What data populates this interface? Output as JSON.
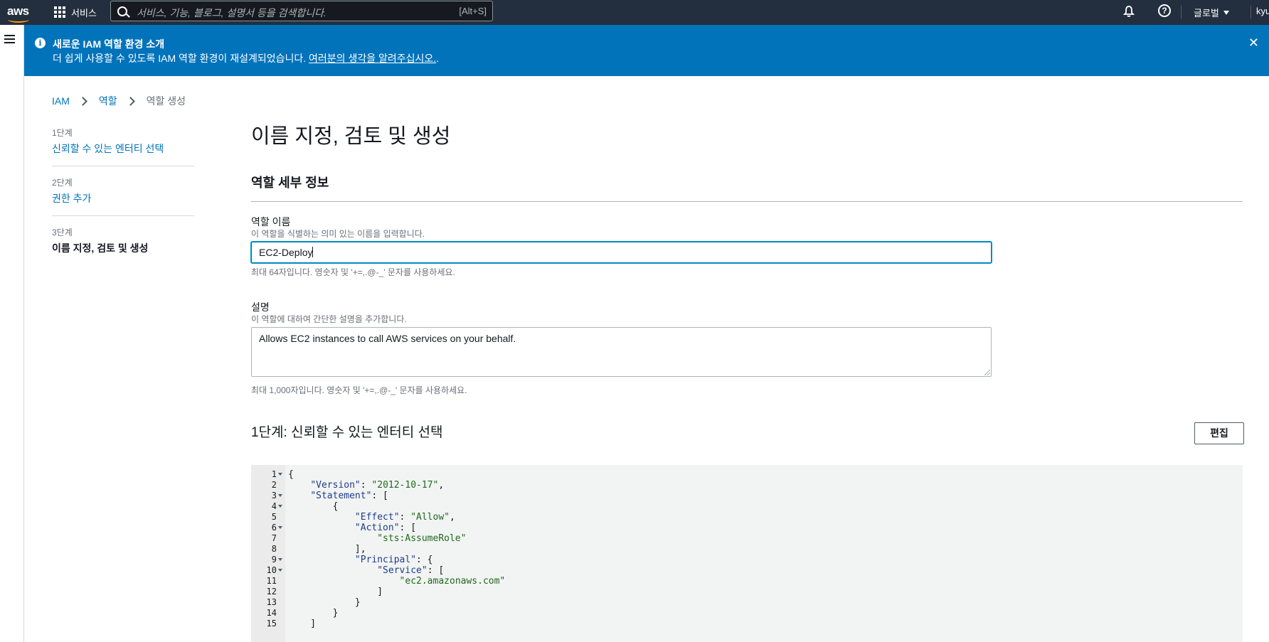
{
  "topnav": {
    "logo_text": "aws",
    "services_label": "서비스",
    "search_placeholder": "서비스, 기능, 블로그, 설명서 등을 검색합니다.",
    "search_shortcut": "[Alt+S]",
    "region_label": "글로벌",
    "user_label": "kyu"
  },
  "banner": {
    "title": "새로운 IAM 역할 환경 소개",
    "message": "더 쉽게 사용할 수 있도록 IAM 역할 환경이 재설계되었습니다. ",
    "link_text": "여러분의 생각을 알려주십시오.",
    "message_end": "."
  },
  "breadcrumb": [
    "IAM",
    "역할",
    "역할 생성"
  ],
  "steps": [
    {
      "num": "1단계",
      "label": "신뢰할 수 있는 엔터티 선택"
    },
    {
      "num": "2단계",
      "label": "권한 추가"
    },
    {
      "num": "3단계",
      "label": "이름 지정, 검토 및 생성"
    }
  ],
  "page": {
    "title": "이름 지정, 검토 및 생성",
    "section_title": "역할 세부 정보"
  },
  "role_name": {
    "label": "역할 이름",
    "description": "이 역할을 식별하는 의미 있는 이름을 입력합니다.",
    "value": "EC2-Deploy",
    "hint": "최대 64자입니다. 영숫자 및 '+=,.@-_' 문자를 사용하세요."
  },
  "role_desc": {
    "label": "설명",
    "description": "이 역할에 대하여 간단한 설명을 추가합니다.",
    "value": "Allows EC2 instances to call AWS services on your behalf.",
    "hint": "최대 1,000자입니다. 영숫자 및 '+=,.@-_' 문자를 사용하세요."
  },
  "trust_section": {
    "title": "1단계: 신뢰할 수 있는 엔터티 선택",
    "edit_label": "편집"
  },
  "policy_lines": [
    {
      "n": "1",
      "fold": true,
      "text": "{"
    },
    {
      "n": "2",
      "fold": false,
      "text": "    \"Version\": \"2012-10-17\","
    },
    {
      "n": "3",
      "fold": true,
      "text": "    \"Statement\": ["
    },
    {
      "n": "4",
      "fold": true,
      "text": "        {"
    },
    {
      "n": "5",
      "fold": false,
      "text": "            \"Effect\": \"Allow\","
    },
    {
      "n": "6",
      "fold": true,
      "text": "            \"Action\": ["
    },
    {
      "n": "7",
      "fold": false,
      "text": "                \"sts:AssumeRole\""
    },
    {
      "n": "8",
      "fold": false,
      "text": "            ],"
    },
    {
      "n": "9",
      "fold": true,
      "text": "            \"Principal\": {"
    },
    {
      "n": "10",
      "fold": true,
      "text": "                \"Service\": ["
    },
    {
      "n": "11",
      "fold": false,
      "text": "                    \"ec2.amazonaws.com\""
    },
    {
      "n": "12",
      "fold": false,
      "text": "                ]"
    },
    {
      "n": "13",
      "fold": false,
      "text": "            }"
    },
    {
      "n": "14",
      "fold": false,
      "text": "        }"
    },
    {
      "n": "15",
      "fold": false,
      "text": "    ]"
    }
  ]
}
